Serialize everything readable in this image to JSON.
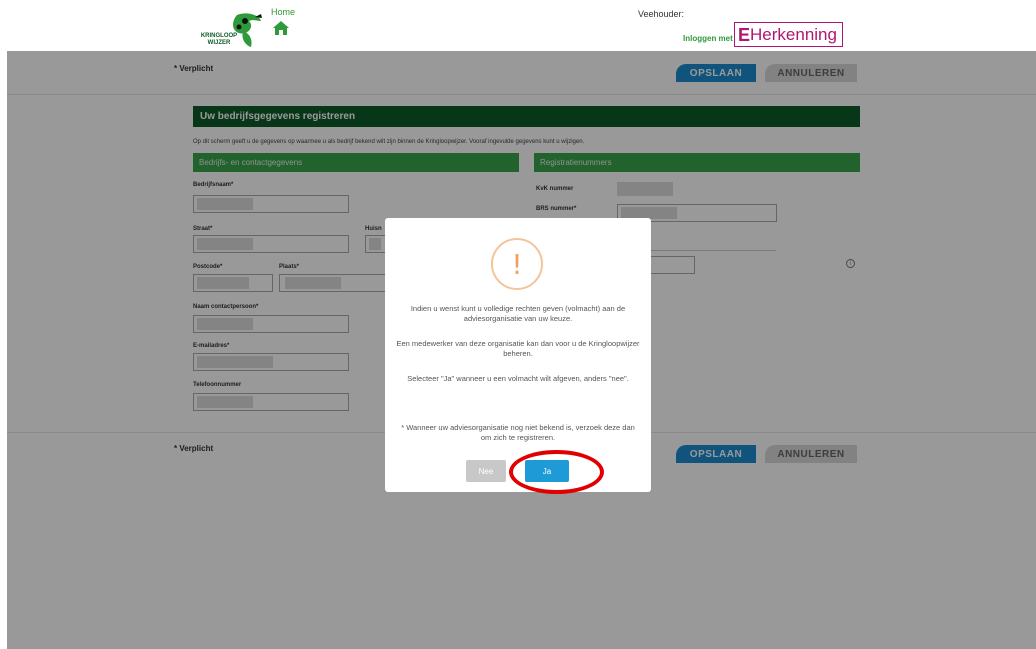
{
  "header": {
    "logo_text_top": "KRINGLOOP",
    "logo_text_bottom": "WIJZER",
    "home_label": "Home",
    "veehouder_label": "Veehouder:",
    "login_label": "Inloggen met",
    "eherkenning_label": "Herkenning",
    "eherkenning_e": "E"
  },
  "form": {
    "required_note": "* Verplicht",
    "save_label": "OPSLAAN",
    "cancel_label": "ANNULEREN",
    "section_title": "Uw bedrijfsgegevens registreren",
    "intro": "Op dit scherm geeft u de gegevens op waarmee u als bedrijf bekend wilt zijn binnen de Kringloopwijzer. Vooraf ingevulde gegevens kunt u wijzigen.",
    "left_header": "Bedrijfs- en contactgegevens",
    "right_header": "Registratienummers",
    "labels": {
      "bedrijfsnaam": "Bedrijfsnaam*",
      "straat": "Straat*",
      "huisnummer": "Huisn",
      "postcode": "Postcode*",
      "plaats": "Plaats*",
      "contactpersoon": "Naam contactpersoon*",
      "email": "E-mailadres*",
      "telefoon": "Telefoonnummer",
      "kvk": "KvK nummer",
      "brs": "BRS nummer*"
    }
  },
  "modal": {
    "p1": "Indien u wenst kunt u volledige rechten geven (volmacht) aan de adviesorganisatie van uw keuze.",
    "p2": "Een medewerker van deze organisatie kan dan voor u de Kringloopwijzer beheren.",
    "p3": "Selecteer \"Ja\" wanneer u een volmacht wilt afgeven, anders \"nee\".",
    "p4": "* Wanneer uw adviesorganisatie nog niet bekend is, verzoek deze dan om zich te registreren.",
    "no_label": "Nee",
    "yes_label": "Ja",
    "warning_glyph": "!"
  },
  "colors": {
    "brand_green": "#0e5a2a",
    "section_green": "#3aa34a",
    "save_blue": "#1c8dd0",
    "yes_blue": "#1e9ad6",
    "highlight_red": "#e00000",
    "eherkenning_magenta": "#b01670"
  }
}
